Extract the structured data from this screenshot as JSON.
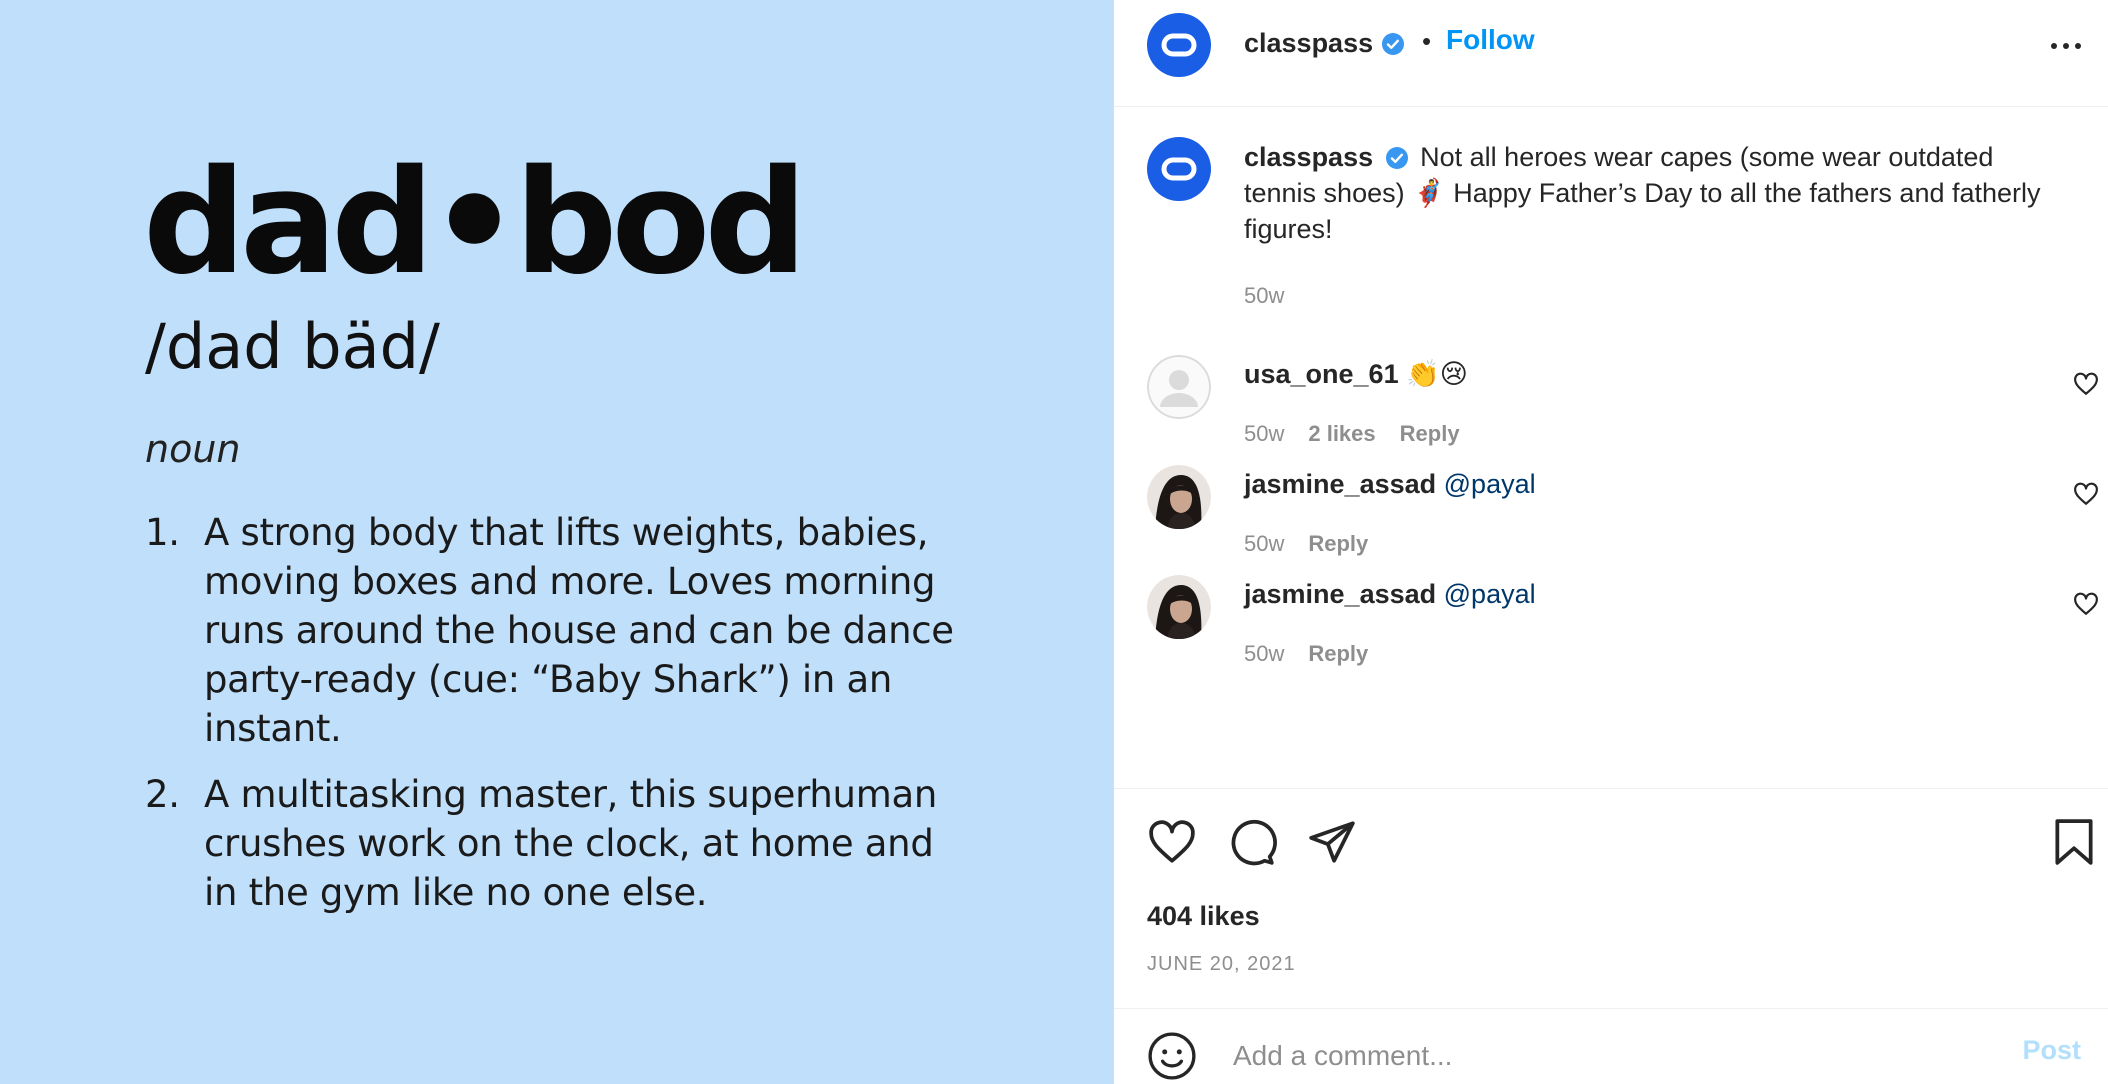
{
  "post_image": {
    "word": "dad•bod",
    "pronunciation": "/dad bäd/",
    "part_of_speech": "noun",
    "definitions": [
      {
        "num": "1.",
        "text": "A strong body that lifts weights, babies, moving boxes and more. Loves morning runs around the house and can be dance party-ready (cue: “Baby Shark”) in an instant."
      },
      {
        "num": "2.",
        "text": "A multitasking master, this superhuman crushes work on the clock, at home and in the gym like no one else."
      }
    ],
    "background_color": "#bfdffb"
  },
  "header": {
    "username": "classpass",
    "separator": "•",
    "follow_label": "Follow",
    "avatar_icon": "classpass-logo-icon",
    "verified_icon": "verified-badge-icon",
    "more_icon": "more-options-icon"
  },
  "caption": {
    "username": "classpass",
    "text": "Not all heroes wear capes (some wear outdated tennis shoes) 🦸‍♂️ Happy Father’s Day to all the fathers and fatherly figures!",
    "time": "50w"
  },
  "comments": [
    {
      "username": "usa_one_61",
      "text": "👏😢",
      "mention": "",
      "time": "50w",
      "likes": "2 likes",
      "reply": "Reply",
      "avatar": "default"
    },
    {
      "username": "jasmine_assad",
      "text": "",
      "mention": "@payal",
      "time": "50w",
      "likes": "",
      "reply": "Reply",
      "avatar": "photo"
    },
    {
      "username": "jasmine_assad",
      "text": "",
      "mention": "@payal",
      "time": "50w",
      "likes": "",
      "reply": "Reply",
      "avatar": "photo"
    }
  ],
  "actions": {
    "like_icon": "heart-icon",
    "comment_icon": "comment-icon",
    "share_icon": "share-icon",
    "save_icon": "bookmark-icon",
    "likes_count": "404 likes",
    "date": "JUNE 20, 2021"
  },
  "add_comment": {
    "placeholder": "Add a comment...",
    "post_label": "Post",
    "emoji_icon": "emoji-icon"
  },
  "colors": {
    "accent": "#0095f6",
    "brand": "#1a5ee6",
    "mention": "#00376b",
    "muted": "#8e8e8e"
  }
}
